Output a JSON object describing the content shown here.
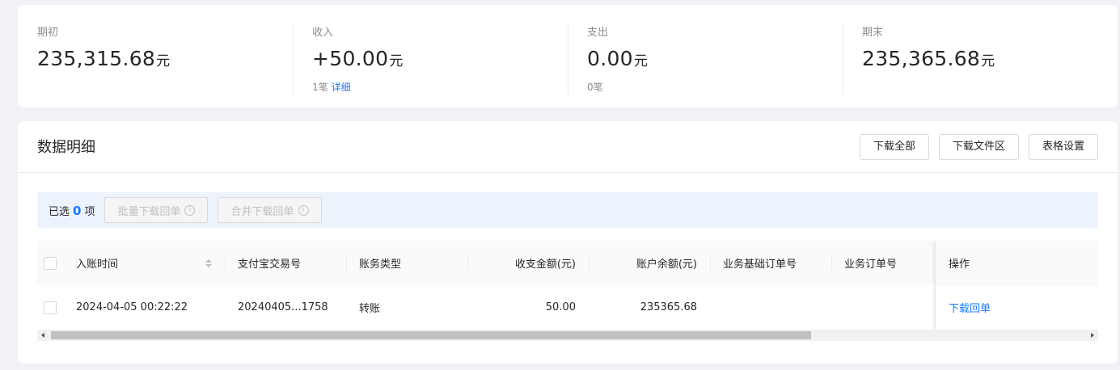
{
  "summary": {
    "opening": {
      "label": "期初",
      "value": "235,315.68",
      "unit": "元"
    },
    "income": {
      "label": "收入",
      "value": "+50.00",
      "unit": "元",
      "count": "1笔",
      "detail_link": "详细"
    },
    "expense": {
      "label": "支出",
      "value": "0.00",
      "unit": "元",
      "count": "0笔"
    },
    "closing": {
      "label": "期末",
      "value": "235,365.68",
      "unit": "元"
    }
  },
  "detail": {
    "title": "数据明细",
    "buttons": {
      "download_all": "下载全部",
      "download_area": "下载文件区",
      "table_settings": "表格设置"
    },
    "selection": {
      "prefix": "已选",
      "count": "0",
      "suffix": "项",
      "batch_download": "批量下载回单",
      "merge_download": "合并下载回单",
      "info_glyph": "i"
    }
  },
  "table": {
    "columns": {
      "time": "入账时间",
      "trade_no": "支付宝交易号",
      "type": "账务类型",
      "amount": "收支金额(元)",
      "balance": "账户余额(元)",
      "base_order": "业务基础订单号",
      "order": "业务订单号",
      "op": "操作"
    },
    "rows": [
      {
        "time": "2024-04-05 00:22:22",
        "trade_no": "20240405...1758",
        "type": "转账",
        "amount": "50.00",
        "balance": "235365.68",
        "base_order": "",
        "order": "",
        "op": "下载回单"
      }
    ]
  },
  "colors": {
    "accent": "#1677ff",
    "selection_bg": "#edf3fd",
    "page_bg": "#f0f2f5"
  },
  "icons": [
    "info-icon",
    "sort-icon",
    "checkbox-icon",
    "scroll-left-arrow-icon",
    "scroll-right-arrow-icon"
  ]
}
